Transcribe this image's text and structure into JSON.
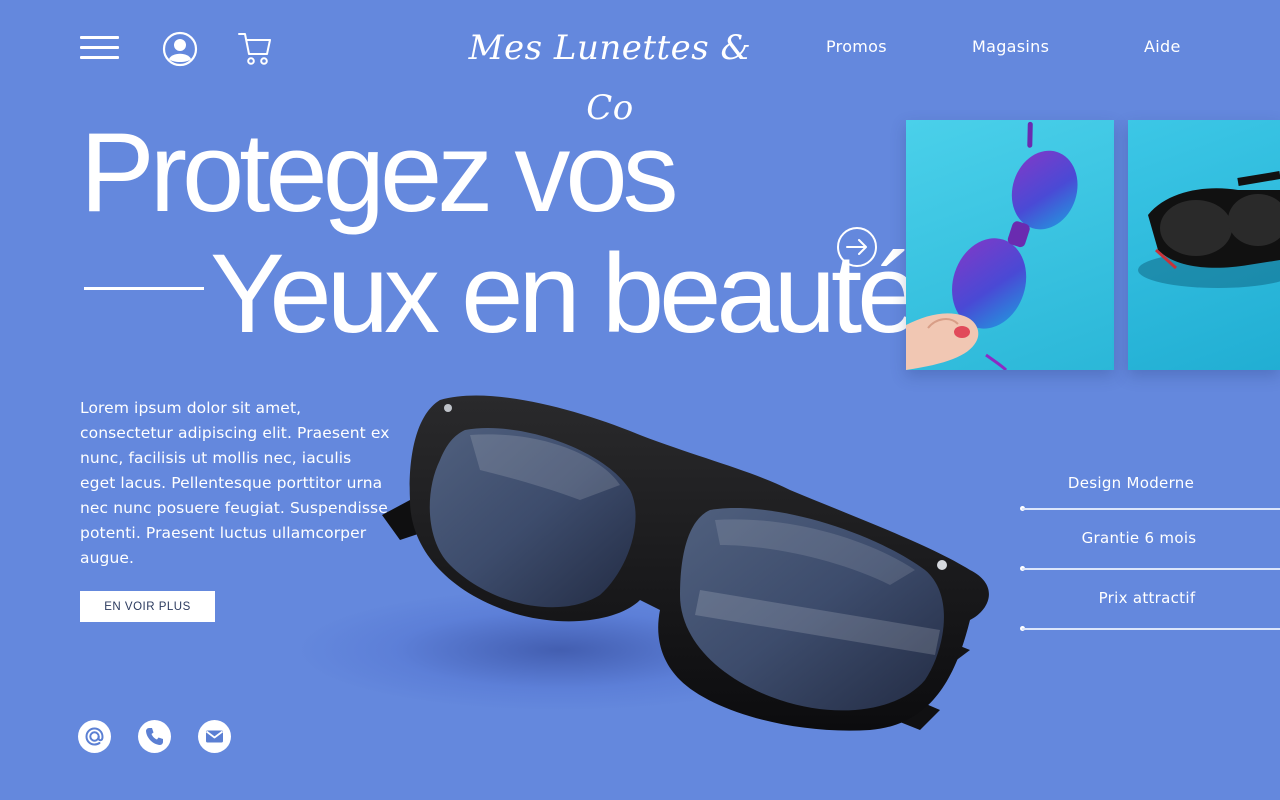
{
  "header": {
    "brand": "Mes Lunettes & Co",
    "nav": [
      {
        "label": "Promos"
      },
      {
        "label": "Magasins"
      },
      {
        "label": "Aide"
      }
    ],
    "icons": [
      "menu-icon",
      "user-icon",
      "cart-icon"
    ]
  },
  "hero": {
    "line1": "Protegez vos",
    "line2": "Yeux en beauté"
  },
  "intro": {
    "text": "Lorem ipsum dolor sit amet, consectetur adipiscing elit. Praesent ex nunc, facilisis ut mollis nec, iaculis eget lacus. Pellentesque porttitor urna nec nunc posuere feugiat. Suspendisse potenti. Praesent luctus ullamcorper augue.",
    "cta_label": "EN VOIR PLUS"
  },
  "features": [
    {
      "label": "Design Moderne"
    },
    {
      "label": "Grantie 6 mois"
    },
    {
      "label": "Prix attractif"
    }
  ],
  "contact_icons": [
    "at-icon",
    "phone-icon",
    "mail-icon"
  ],
  "gallery": {
    "next_icon": "arrow-right-icon",
    "tiles": [
      "purple-sunglasses-photo",
      "black-sunglasses-photo"
    ]
  },
  "colors": {
    "background": "#6488dd",
    "tile": "#35c3df",
    "text": "#ffffff",
    "cta_text": "#2b3a5e"
  }
}
